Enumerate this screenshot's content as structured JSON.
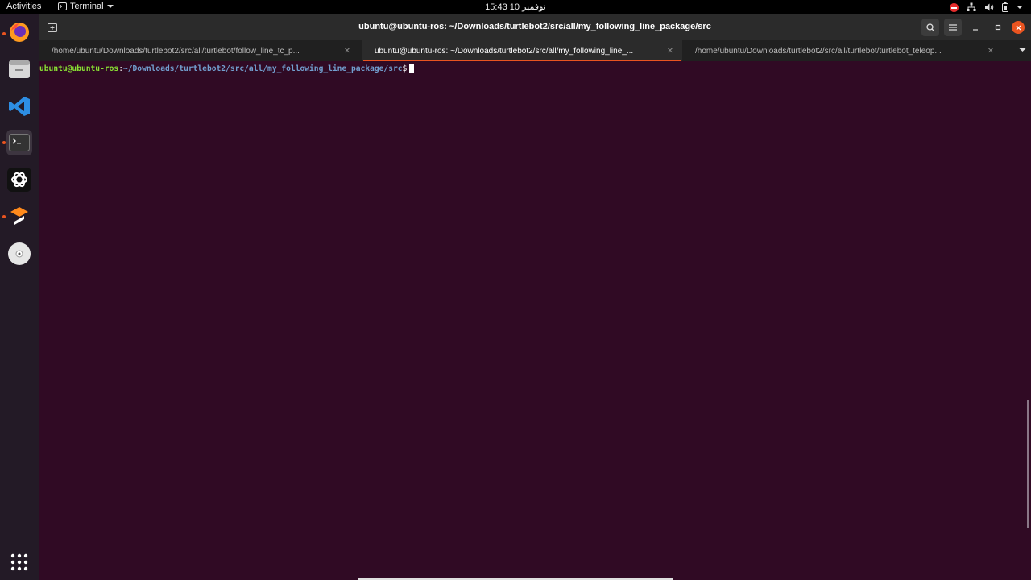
{
  "topbar": {
    "activities": "Activities",
    "app_name": "Terminal",
    "clock": "نوفمبر 10  15:43"
  },
  "dock": {
    "items": [
      {
        "name": "firefox"
      },
      {
        "name": "files"
      },
      {
        "name": "vscode"
      },
      {
        "name": "terminal"
      },
      {
        "name": "chatgpt"
      },
      {
        "name": "sublime-merge"
      },
      {
        "name": "dvd"
      }
    ]
  },
  "window": {
    "title": "ubuntu@ubuntu-ros: ~/Downloads/turtlebot2/src/all/my_following_line_package/src",
    "tabs": [
      {
        "label": "/home/ubuntu/Downloads/turtlebot2/src/all/turtlebot/follow_line_tc_p..."
      },
      {
        "label": "ubuntu@ubuntu-ros: ~/Downloads/turtlebot2/src/all/my_following_line_..."
      },
      {
        "label": "/home/ubuntu/Downloads/turtlebot2/src/all/turtlebot/turtlebot_teleop..."
      }
    ]
  },
  "terminal": {
    "prompt_user": "ubuntu@ubuntu-ros",
    "prompt_sep": ":",
    "prompt_path": "~/Downloads/turtlebot2/src/all/my_following_line_package/src",
    "prompt_symbol": "$"
  },
  "colors": {
    "terminal_bg": "#300a24",
    "accent": "#e95420",
    "prompt_user": "#8ae234",
    "prompt_path": "#729fcf"
  }
}
